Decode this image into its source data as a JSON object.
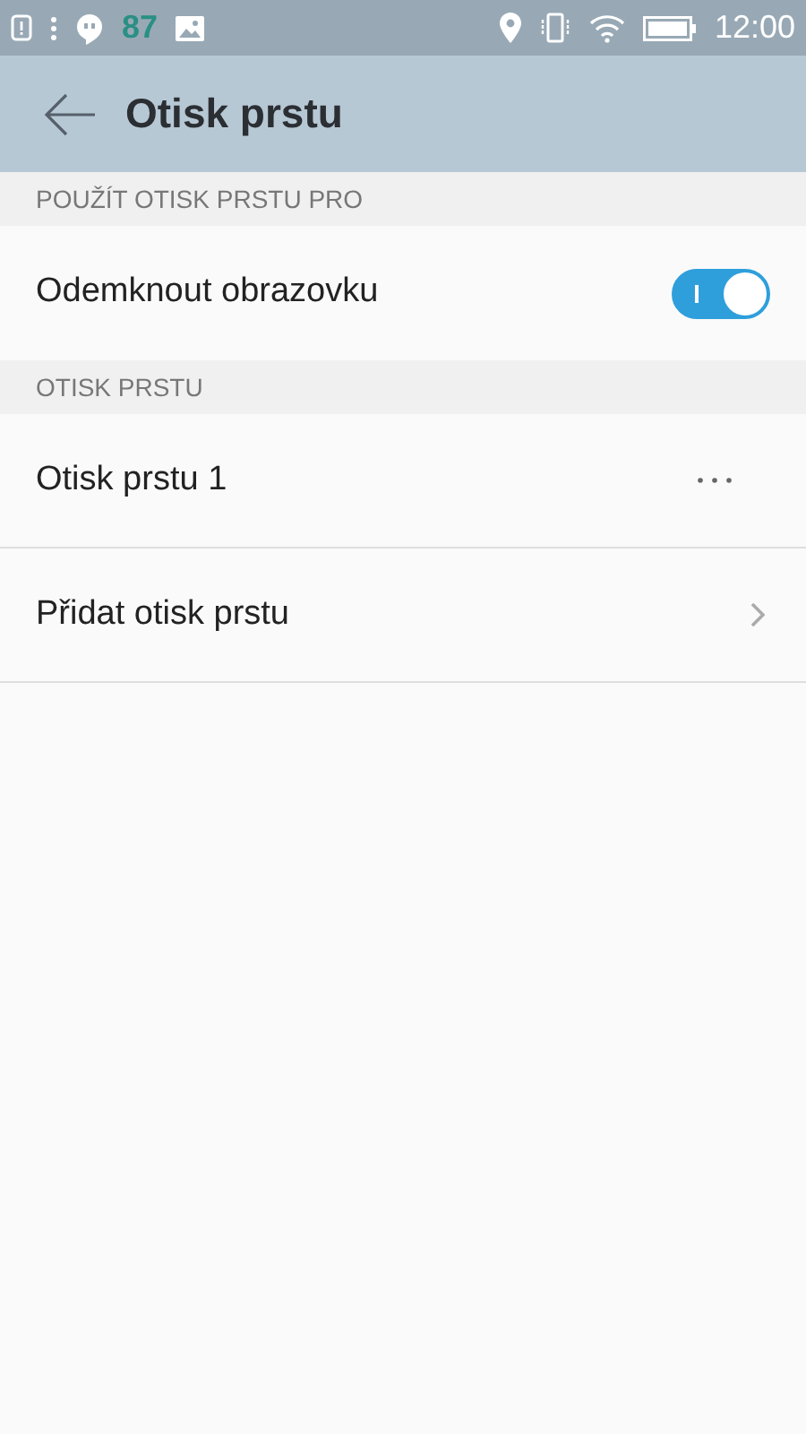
{
  "status_bar": {
    "notification_count": "87",
    "time": "12:00"
  },
  "header": {
    "title": "Otisk prstu"
  },
  "sections": [
    {
      "title": "POUŽÍT OTISK PRSTU PRO",
      "items": [
        {
          "kind": "toggle",
          "label": "Odemknout obrazovku",
          "on": true
        }
      ]
    },
    {
      "title": "OTISK PRSTU",
      "items": [
        {
          "kind": "menu",
          "label": "Otisk prstu 1"
        },
        {
          "kind": "link",
          "label": "Přidat otisk prstu"
        }
      ]
    }
  ]
}
